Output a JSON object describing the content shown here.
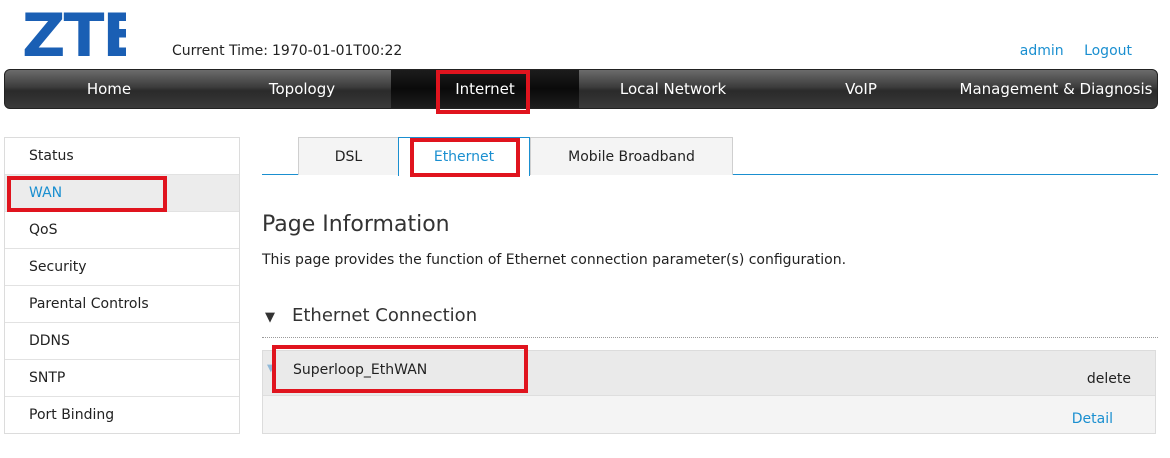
{
  "brand": {
    "logo_text": "ZTE",
    "logo_color": "#1a5fb4"
  },
  "header": {
    "current_time_label": "Current Time:",
    "current_time_value": "1970-01-01T00:22",
    "user": "admin",
    "logout": "Logout"
  },
  "mainnav": {
    "tabs": [
      {
        "label": "Home"
      },
      {
        "label": "Topology"
      },
      {
        "label": "Internet"
      },
      {
        "label": "Local Network"
      },
      {
        "label": "VoIP"
      },
      {
        "label": "Management & Diagnosis"
      }
    ],
    "active": "Internet"
  },
  "sidebar": {
    "items": [
      {
        "label": "Status"
      },
      {
        "label": "WAN"
      },
      {
        "label": "QoS"
      },
      {
        "label": "Security"
      },
      {
        "label": "Parental Controls"
      },
      {
        "label": "DDNS"
      },
      {
        "label": "SNTP"
      },
      {
        "label": "Port Binding"
      }
    ],
    "active": "WAN"
  },
  "subtabs": {
    "items": [
      {
        "label": "DSL"
      },
      {
        "label": "Ethernet"
      },
      {
        "label": "Mobile Broadband"
      }
    ],
    "active": "Ethernet"
  },
  "content": {
    "page_title": "Page Information",
    "page_desc": "This page provides the function of Ethernet connection parameter(s) configuration.",
    "section_title": "Ethernet Connection",
    "connection": {
      "name": "Superloop_EthWAN",
      "delete_label": "delete",
      "detail_label": "Detail"
    }
  },
  "colors": {
    "accent": "#1a8fd0",
    "highlight": "#e0141e"
  }
}
